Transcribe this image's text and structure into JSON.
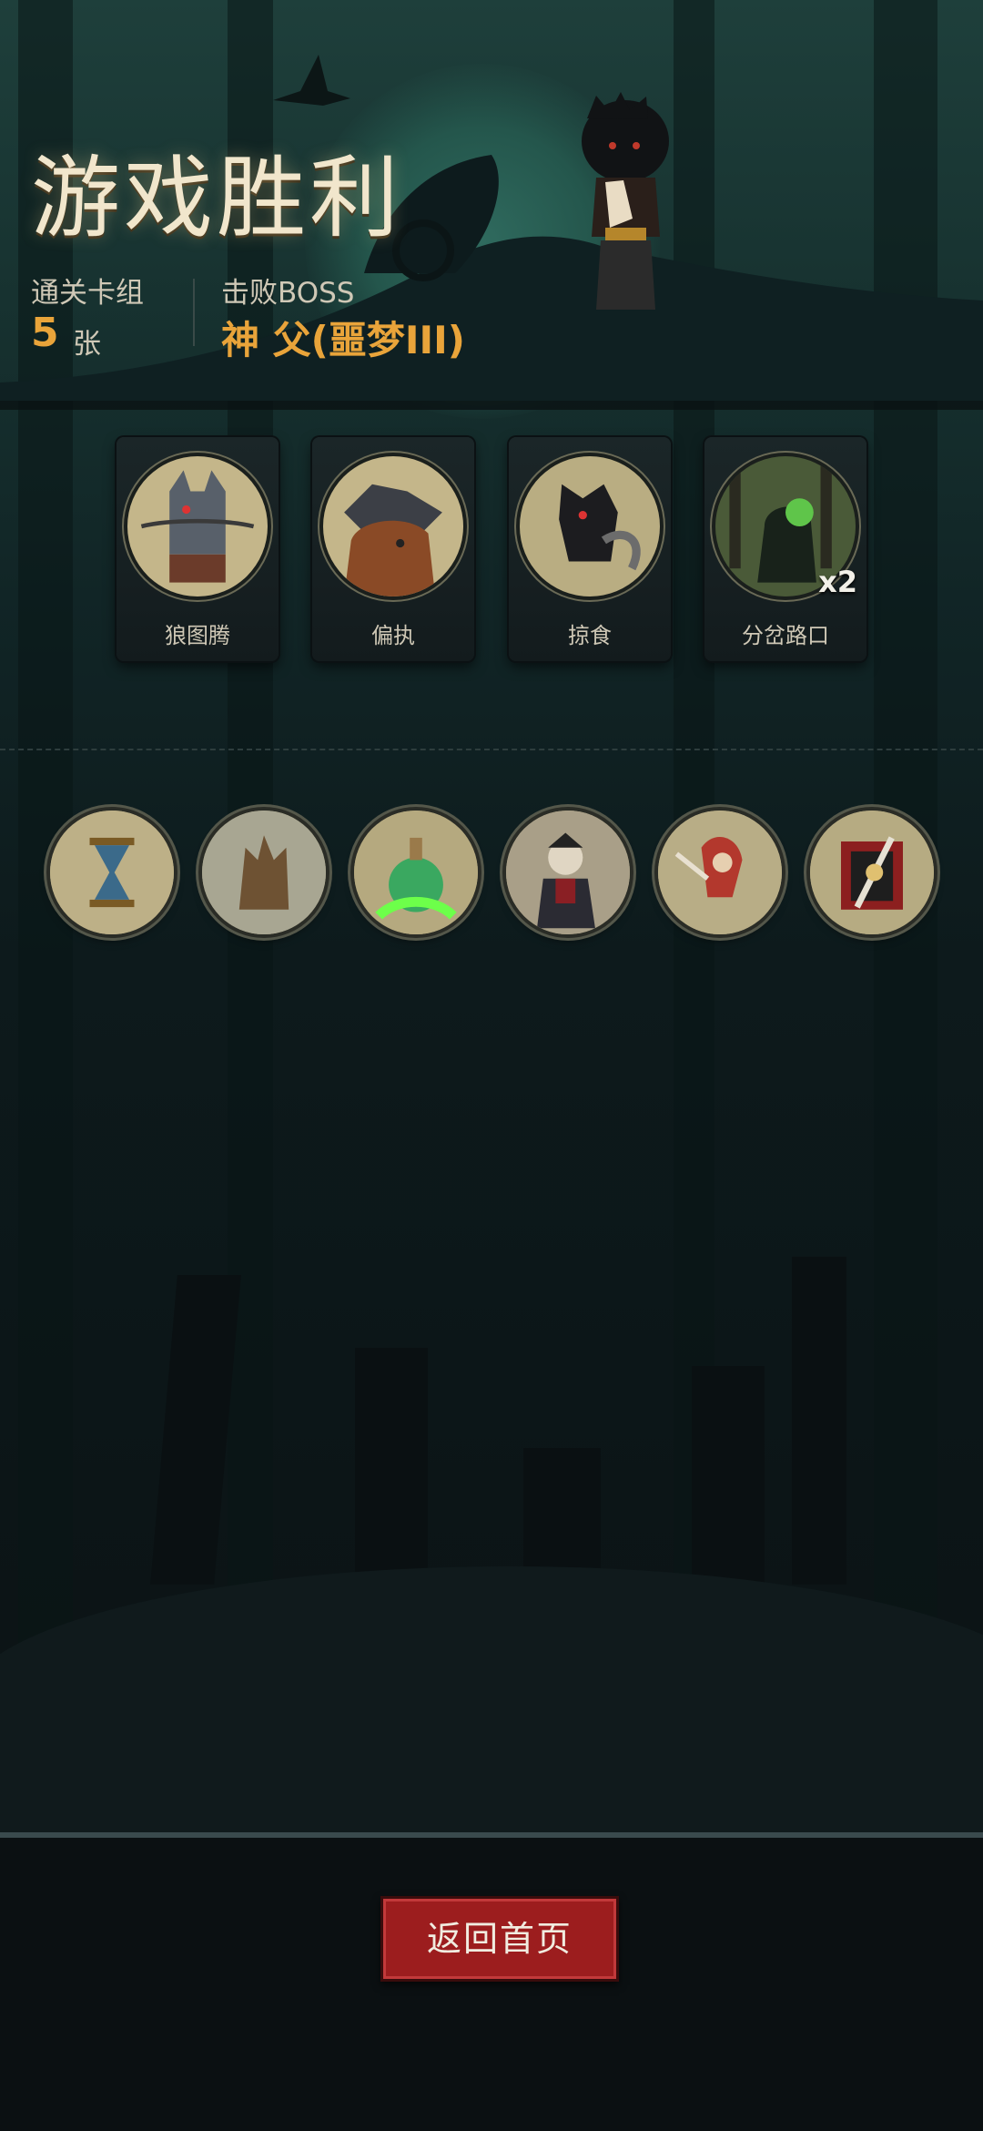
{
  "header": {
    "title": "游戏胜利",
    "deck_label": "通关卡组",
    "deck_count": "5",
    "deck_unit": "张",
    "boss_label": "击败BOSS",
    "boss_name": "神 父(噩梦III)"
  },
  "bosses": [
    {
      "name": "狼图腾",
      "icon": "wolf-totem-icon"
    },
    {
      "name": "偏执",
      "icon": "werewolf-bear-icon"
    },
    {
      "name": "掠食",
      "icon": "predator-wolf-icon"
    },
    {
      "name": "分岔路口",
      "icon": "forest-crossroads-icon",
      "count": "x2"
    }
  ],
  "relics": [
    {
      "icon": "hourglass-icon"
    },
    {
      "icon": "tree-stump-icon"
    },
    {
      "icon": "green-potion-icon"
    },
    {
      "icon": "vampire-icon"
    },
    {
      "icon": "red-hood-icon"
    },
    {
      "icon": "sword-banner-icon"
    }
  ],
  "footer": {
    "home_button": "返回首页"
  },
  "colors": {
    "accent_gold": "#e9a43a",
    "button_red": "#9c1d1e"
  }
}
